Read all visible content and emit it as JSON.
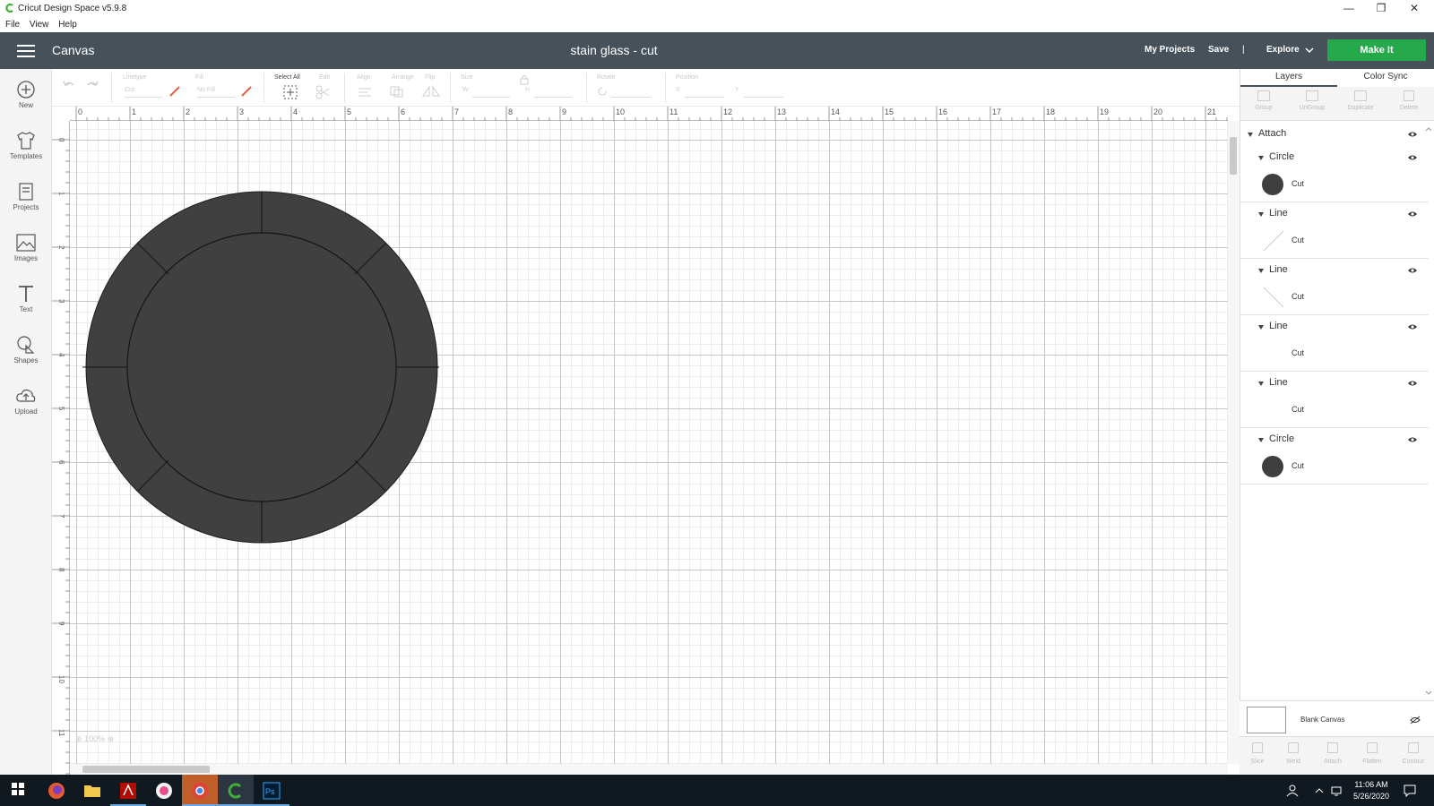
{
  "window": {
    "title": "Cricut Design Space  v5.9.8",
    "controls": [
      "minimize-icon",
      "restore-icon",
      "close-icon"
    ]
  },
  "menu": [
    "File",
    "View",
    "Help"
  ],
  "header": {
    "section": "Canvas",
    "project_title": "stain glass - cut",
    "my_projects": "My Projects",
    "save": "Save",
    "divider": "|",
    "explore": "Explore",
    "make_it": "Make It"
  },
  "leftbar": [
    {
      "label": "New",
      "icon": "plus-circle-icon"
    },
    {
      "label": "Templates",
      "icon": "shirt-icon"
    },
    {
      "label": "Projects",
      "icon": "book-icon"
    },
    {
      "label": "Images",
      "icon": "image-icon"
    },
    {
      "label": "Text",
      "icon": "text-icon"
    },
    {
      "label": "Shapes",
      "icon": "shapes-icon"
    },
    {
      "label": "Upload",
      "icon": "cloud-upload-icon"
    }
  ],
  "toolbar": {
    "linetype_label": "Linetype",
    "linetype_value": "Cut",
    "fill_label": "Fill",
    "fill_value": "No Fill",
    "select_all": "Select All",
    "edit": "Edit",
    "align": "Align",
    "arrange": "Arrange",
    "flip": "Flip",
    "size": "Size",
    "w": "W",
    "h": "H",
    "rotate": "Rotate",
    "position": "Position",
    "x": "X",
    "y": "Y"
  },
  "ruler": {
    "top": [
      "0",
      "1",
      "2",
      "3",
      "4",
      "5",
      "6",
      "7",
      "8",
      "9",
      "10",
      "11",
      "12",
      "13",
      "14",
      "15",
      "16",
      "17",
      "18",
      "19",
      "20",
      "21"
    ],
    "left": [
      "0",
      "1",
      "2",
      "3",
      "4",
      "5",
      "6",
      "7",
      "8",
      "9",
      "10",
      "11"
    ]
  },
  "zoom": "100%",
  "right_panel": {
    "tabs": [
      "Layers",
      "Color Sync"
    ],
    "tools": [
      "Group",
      "UnGroup",
      "Duplicate",
      "Delete"
    ],
    "group_name": "Attach",
    "layers": [
      {
        "name": "Circle",
        "op": "Cut",
        "swatch": "circle"
      },
      {
        "name": "Line",
        "op": "Cut",
        "swatch": "line-diag1"
      },
      {
        "name": "Line",
        "op": "Cut",
        "swatch": "line-diag2"
      },
      {
        "name": "Line",
        "op": "Cut",
        "swatch": "none"
      },
      {
        "name": "Line",
        "op": "Cut",
        "swatch": "none"
      },
      {
        "name": "Circle",
        "op": "Cut",
        "swatch": "circle"
      }
    ],
    "blank_canvas": "Blank Canvas",
    "bottom_tools": [
      "Slice",
      "Weld",
      "Attach",
      "Flatten",
      "Contour"
    ]
  },
  "colors": {
    "header": "#475159",
    "make_it": "#25a94a",
    "shape_fill": "#404040"
  },
  "taskbar": {
    "time": "11:06 AM",
    "date": "5/26/2020"
  }
}
